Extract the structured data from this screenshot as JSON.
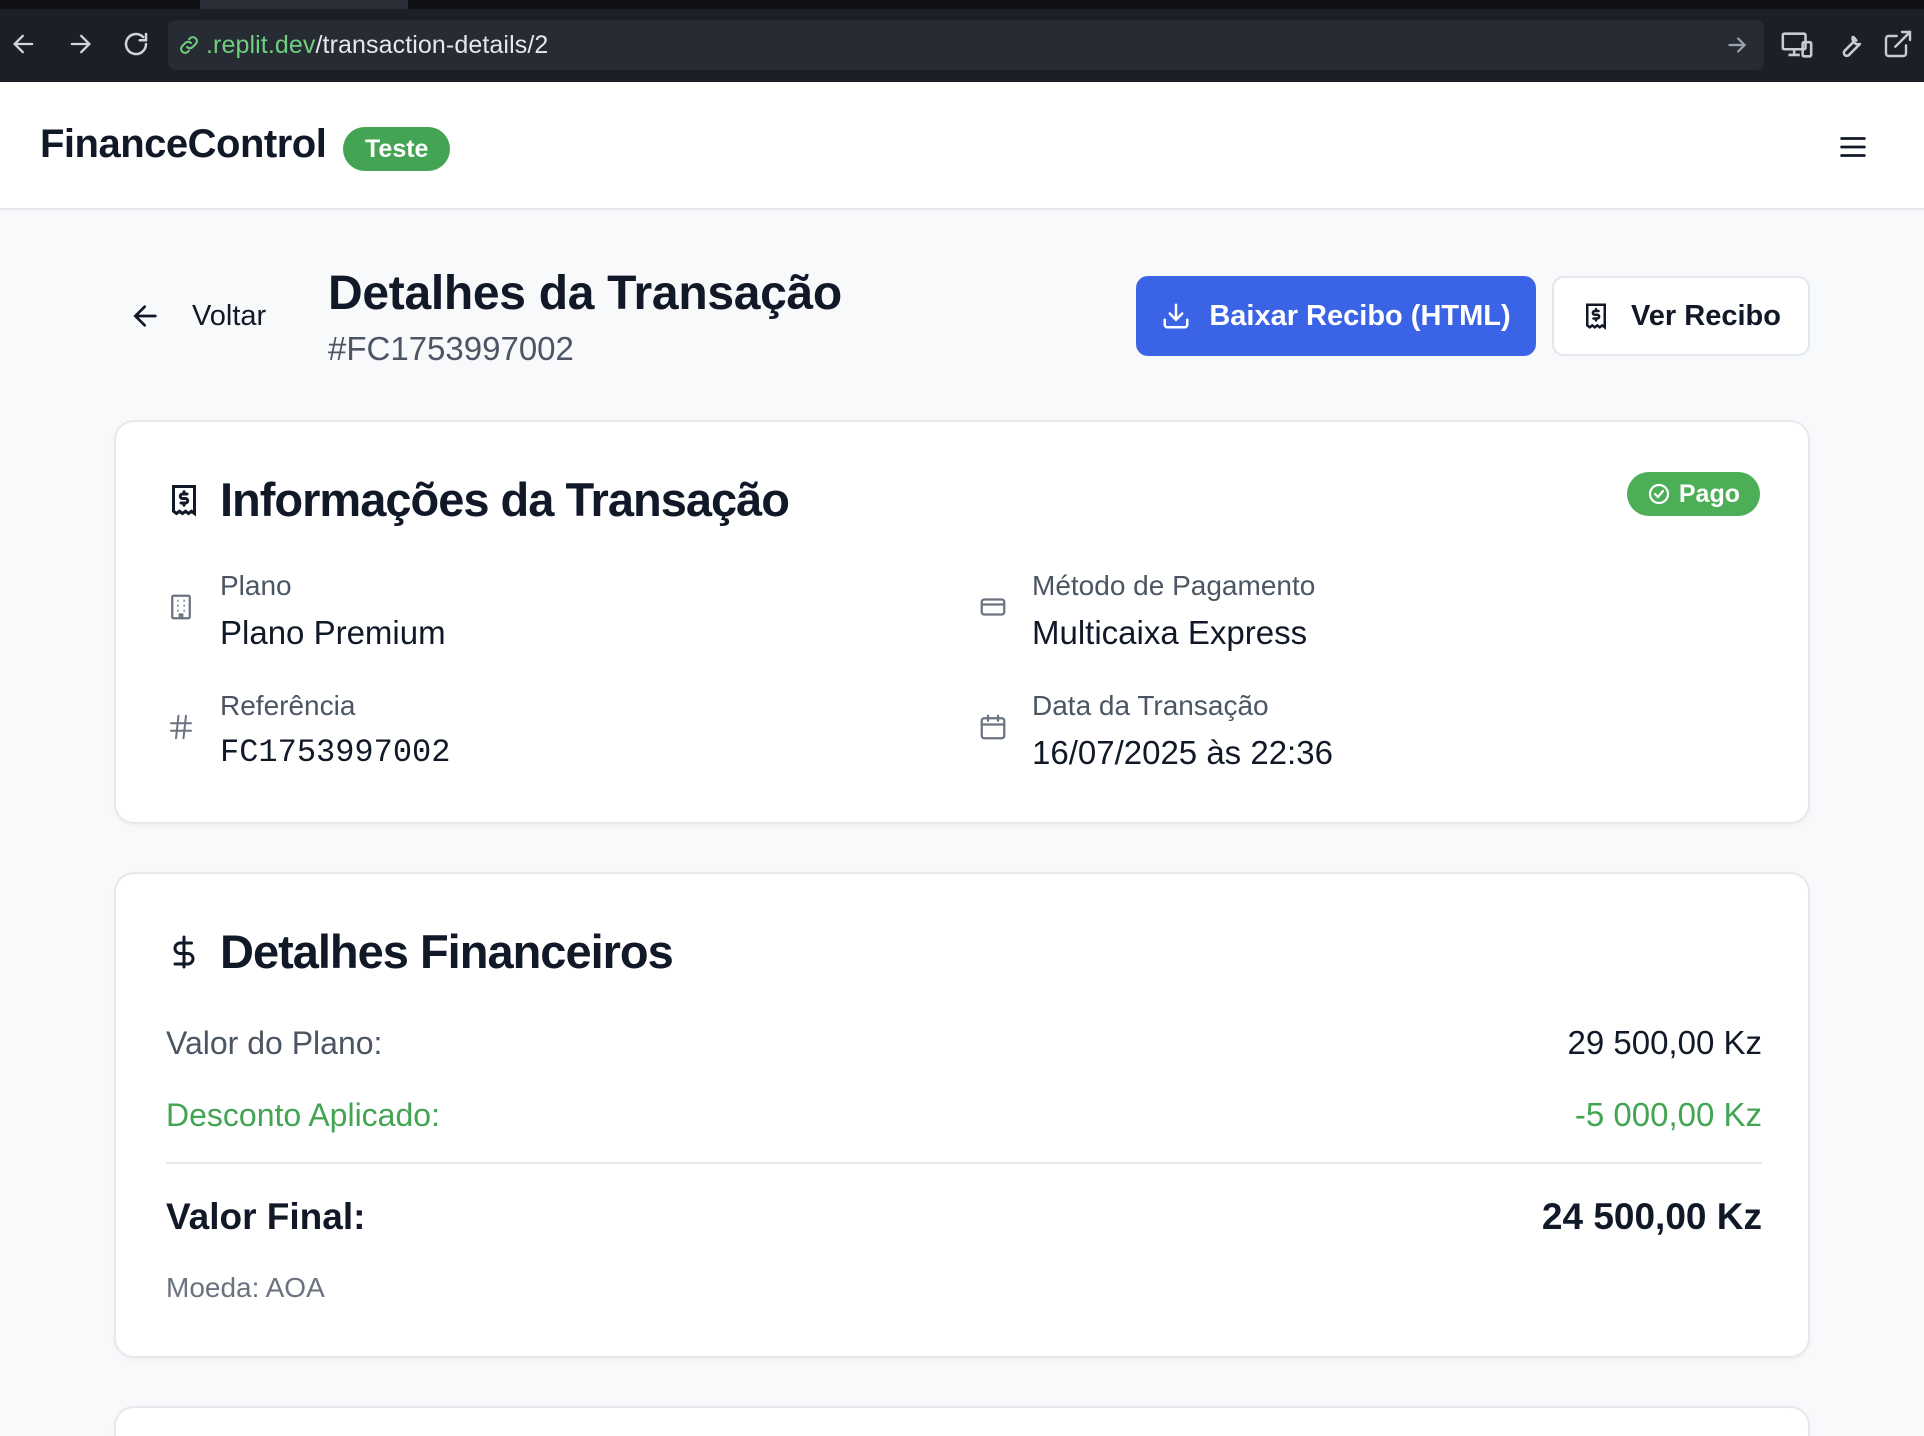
{
  "browser": {
    "url_domain": ".replit.dev",
    "url_path": "/transaction-details/2"
  },
  "header": {
    "brand": "FinanceControl",
    "env_badge": "Teste"
  },
  "page": {
    "back_label": "Voltar",
    "title": "Detalhes da Transação",
    "subtitle": "#FC1753997002",
    "download_button": "Baixar Recibo (HTML)",
    "view_button": "Ver Recibo"
  },
  "transaction_info": {
    "title": "Informações da Transação",
    "status": "Pago",
    "plan_label": "Plano",
    "plan_value": "Plano Premium",
    "method_label": "Método de Pagamento",
    "method_value": "Multicaixa Express",
    "reference_label": "Referência",
    "reference_value": "FC1753997002",
    "date_label": "Data da Transação",
    "date_value": "16/07/2025 às 22:36"
  },
  "financial": {
    "title": "Detalhes Financeiros",
    "plan_value_label": "Valor do Plano:",
    "plan_value": "29 500,00 Kz",
    "discount_label": "Desconto Aplicado:",
    "discount_value": "-5 000,00 Kz",
    "final_label": "Valor Final:",
    "final_value": "24 500,00 Kz",
    "currency": "Moeda: AOA"
  },
  "colors": {
    "primary": "#3b63e6",
    "success": "#43a453",
    "chrome": "#1c1f26"
  }
}
